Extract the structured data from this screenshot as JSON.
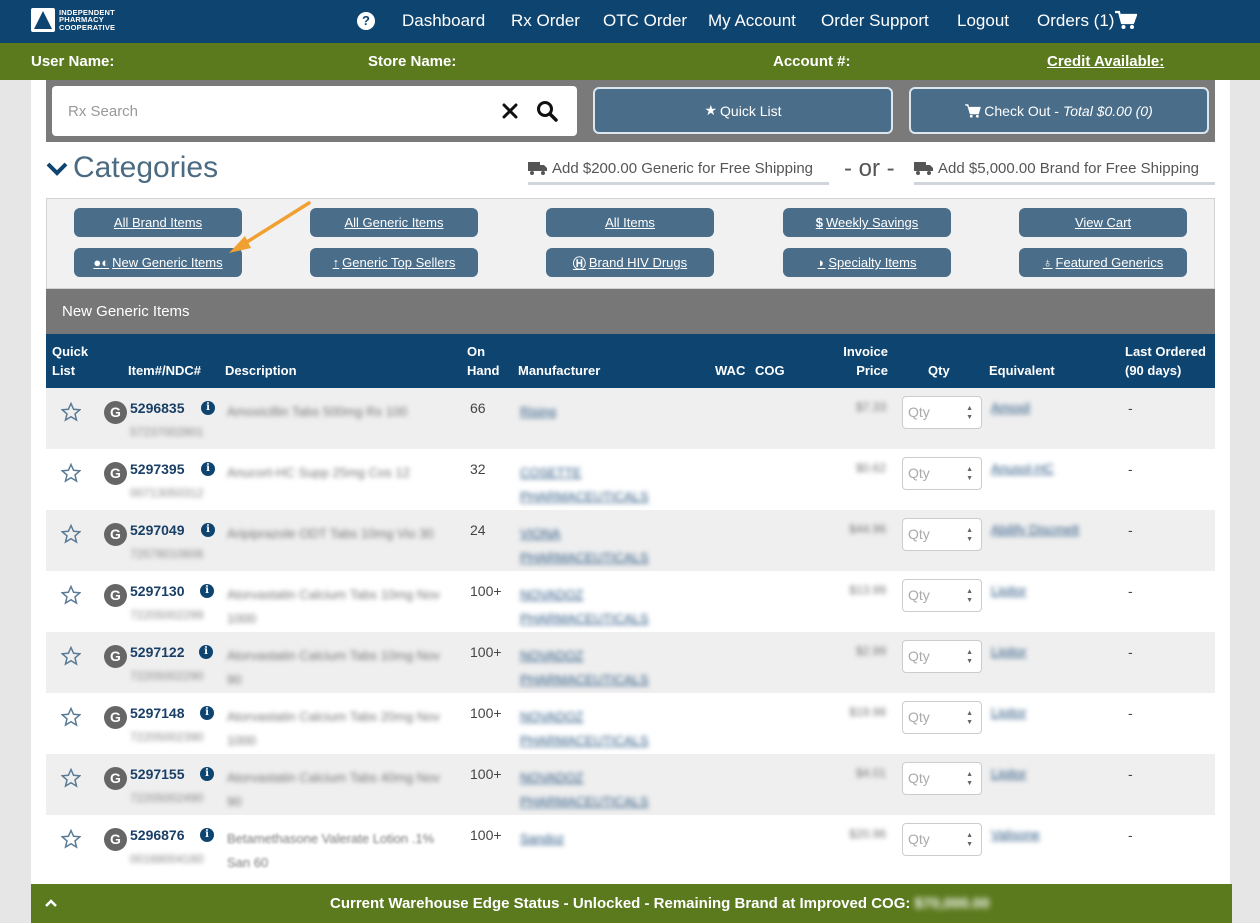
{
  "brand": {
    "logo_text_1": "INDEPENDENT",
    "logo_text_2": "PHARMACY",
    "logo_text_3": "COOPERATIVE",
    "logo_mark": "IPC"
  },
  "nav": {
    "help": "?",
    "items": [
      "Dashboard",
      "Rx Order",
      "OTC Order",
      "My Account",
      "Order Support",
      "Logout"
    ],
    "orders": "Orders (1)"
  },
  "userbar": {
    "user": "User Name:",
    "store": "Store Name:",
    "account": "Account #:",
    "credit": "Credit Available:"
  },
  "search": {
    "placeholder": "Rx Search"
  },
  "quick_list": "Quick List",
  "checkout": {
    "label": "Check Out - ",
    "total": "Total $0.00 (0)"
  },
  "categories_title": "Categories",
  "shipping": {
    "generic": "Add $200.00 Generic for Free Shipping",
    "or": "- or -",
    "brand": "Add $5,000.00 Brand for Free Shipping"
  },
  "category_buttons": {
    "all_brand": "All Brand Items",
    "all_generic": "All Generic Items",
    "all_items": "All Items",
    "weekly": "Weekly Savings",
    "view_cart": "View Cart",
    "new_generic": "New Generic Items",
    "top_sellers": "Generic Top Sellers",
    "hiv": "Brand HIV Drugs",
    "specialty": "Specialty Items",
    "featured": "Featured Generics"
  },
  "section_title": "New Generic Items",
  "table": {
    "headers": {
      "quick_list_1": "Quick",
      "quick_list_2": "List",
      "item": "Item#/NDC#",
      "desc": "Description",
      "onhand_1": "On",
      "onhand_2": "Hand",
      "mfr": "Manufacturer",
      "wac": "WAC",
      "cog": "COG",
      "price_1": "Invoice",
      "price_2": "Price",
      "qty": "Qty",
      "equiv": "Equivalent",
      "last_1": "Last Ordered",
      "last_2": "(90 days)"
    },
    "qty_placeholder": "Qty",
    "rows": [
      {
        "badge": "G",
        "item": "5296835",
        "ndc": "57237002801",
        "desc": "Amoxicillin Tabs 500mg Rx 100",
        "onhand": "66",
        "mfr": "Rising",
        "price": "$7.33",
        "equiv": "Amoxil",
        "last": "-"
      },
      {
        "badge": "G",
        "item": "5297395",
        "ndc": "00713050312",
        "desc": "Anucort-HC Supp 25mg Cos 12",
        "onhand": "32",
        "mfr": "COSETTE PHARMACEUTICALS",
        "price": "$0.62",
        "equiv": "Anusol-HC",
        "last": "-"
      },
      {
        "badge": "G",
        "item": "5297049",
        "ndc": "72578010606",
        "desc": "Aripiprazole ODT Tabs 10mg Vio 30",
        "onhand": "24",
        "mfr": "VIONA PHARMACEUTICALS",
        "price": "$44.96",
        "equiv": "Abilify Discmelt",
        "last": "-"
      },
      {
        "badge": "G",
        "item": "5297130",
        "ndc": "72205002299",
        "desc": "Atorvastatin Calcium Tabs 10mg Nov 1000",
        "onhand": "100+",
        "mfr": "NOVADOZ PHARMACEUTICALS",
        "price": "$13.99",
        "equiv": "Lipitor",
        "last": "-"
      },
      {
        "badge": "G",
        "item": "5297122",
        "ndc": "72205002290",
        "desc": "Atorvastatin Calcium Tabs 10mg Nov 90",
        "onhand": "100+",
        "mfr": "NOVADOZ PHARMACEUTICALS",
        "price": "$2.99",
        "equiv": "Lipitor",
        "last": "-"
      },
      {
        "badge": "G",
        "item": "5297148",
        "ndc": "72205002390",
        "desc": "Atorvastatin Calcium Tabs 20mg Nov 1000",
        "onhand": "100+",
        "mfr": "NOVADOZ PHARMACEUTICALS",
        "price": "$19.98",
        "equiv": "Lipitor",
        "last": "-"
      },
      {
        "badge": "G",
        "item": "5297155",
        "ndc": "72205002490",
        "desc": "Atorvastatin Calcium Tabs 40mg Nov 90",
        "onhand": "100+",
        "mfr": "NOVADOZ PHARMACEUTICALS",
        "price": "$4.01",
        "equiv": "Lipitor",
        "last": "-"
      },
      {
        "badge": "G",
        "item": "5296876",
        "ndc": "00168004160",
        "desc": "Betamethasone Valerate Lotion .1% San 60",
        "onhand": "100+",
        "mfr": "Sandoz",
        "price": "$20.96",
        "equiv": "Valisone",
        "last": "-"
      }
    ]
  },
  "status": {
    "text": "Current Warehouse Edge Status - Unlocked - Remaining Brand at Improved COG:",
    "value": "$70,000.00"
  },
  "colors": {
    "nav": "#0e4470",
    "green": "#5b7a1e",
    "button": "#4a6e8a",
    "arrow": "#f0a030"
  }
}
